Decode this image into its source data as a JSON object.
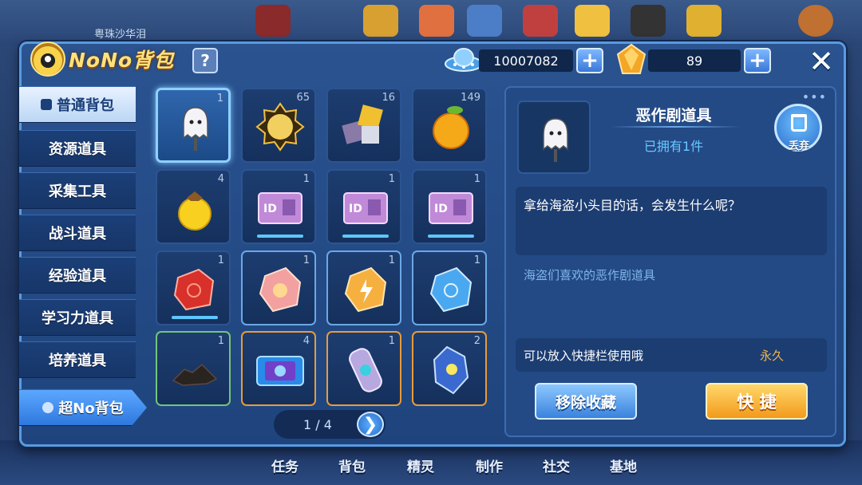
{
  "header": {
    "title": "NoNo背包",
    "help_label": "?",
    "coins": "10007082",
    "gems": "89",
    "plus_label": "+",
    "close_label": "✕"
  },
  "background": {
    "top_label": "粤珠沙华泪",
    "bottom_tabs": [
      "任务",
      "背包",
      "精灵",
      "制作",
      "社交",
      "基地"
    ]
  },
  "sidebar": {
    "items": [
      {
        "label": "普通背包"
      },
      {
        "label": "资源道具"
      },
      {
        "label": "采集工具"
      },
      {
        "label": "战斗道具"
      },
      {
        "label": "经验道具"
      },
      {
        "label": "学习力道具"
      },
      {
        "label": "培养道具"
      },
      {
        "label": "超No背包"
      }
    ]
  },
  "grid": {
    "items": [
      {
        "icon": "ghost-icon",
        "count": "1"
      },
      {
        "icon": "badge-icon",
        "count": "65"
      },
      {
        "icon": "cube-icon",
        "count": "16"
      },
      {
        "icon": "orange-fruit-icon",
        "count": "149"
      },
      {
        "icon": "yellow-fruit-icon",
        "count": "4"
      },
      {
        "icon": "id-card-icon",
        "count": "1"
      },
      {
        "icon": "id-card-icon",
        "count": "1"
      },
      {
        "icon": "id-card-icon",
        "count": "1"
      },
      {
        "icon": "red-stone-icon",
        "count": "1"
      },
      {
        "icon": "pink-stone-icon",
        "count": "1"
      },
      {
        "icon": "orange-stone-icon",
        "count": "1"
      },
      {
        "icon": "blue-stone-icon",
        "count": "1"
      },
      {
        "icon": "ore-icon",
        "count": "1"
      },
      {
        "icon": "chip-icon",
        "count": "4"
      },
      {
        "icon": "capsule-icon",
        "count": "1"
      },
      {
        "icon": "crystal-icon",
        "count": "2"
      }
    ]
  },
  "pager": {
    "label": "1 / 4",
    "next_label": "❯"
  },
  "detail": {
    "more": "•••",
    "name": "恶作剧道具",
    "owned": "已拥有1件",
    "discard_label": "丢弃",
    "description": "拿给海盗小头目的话，会发生什么呢？",
    "subtext": "海盗们喜欢的恶作剧道具",
    "quickbar_text": "可以放入快捷栏使用哦",
    "duration": "永久",
    "remove_button": "移除收藏",
    "quick_button": "快 捷"
  },
  "colors": {
    "accent": "#5a9ae0",
    "gold": "#ffe27a",
    "quick": "#f29a1c",
    "owned": "#69c8ff",
    "duration": "#f0b64a"
  }
}
